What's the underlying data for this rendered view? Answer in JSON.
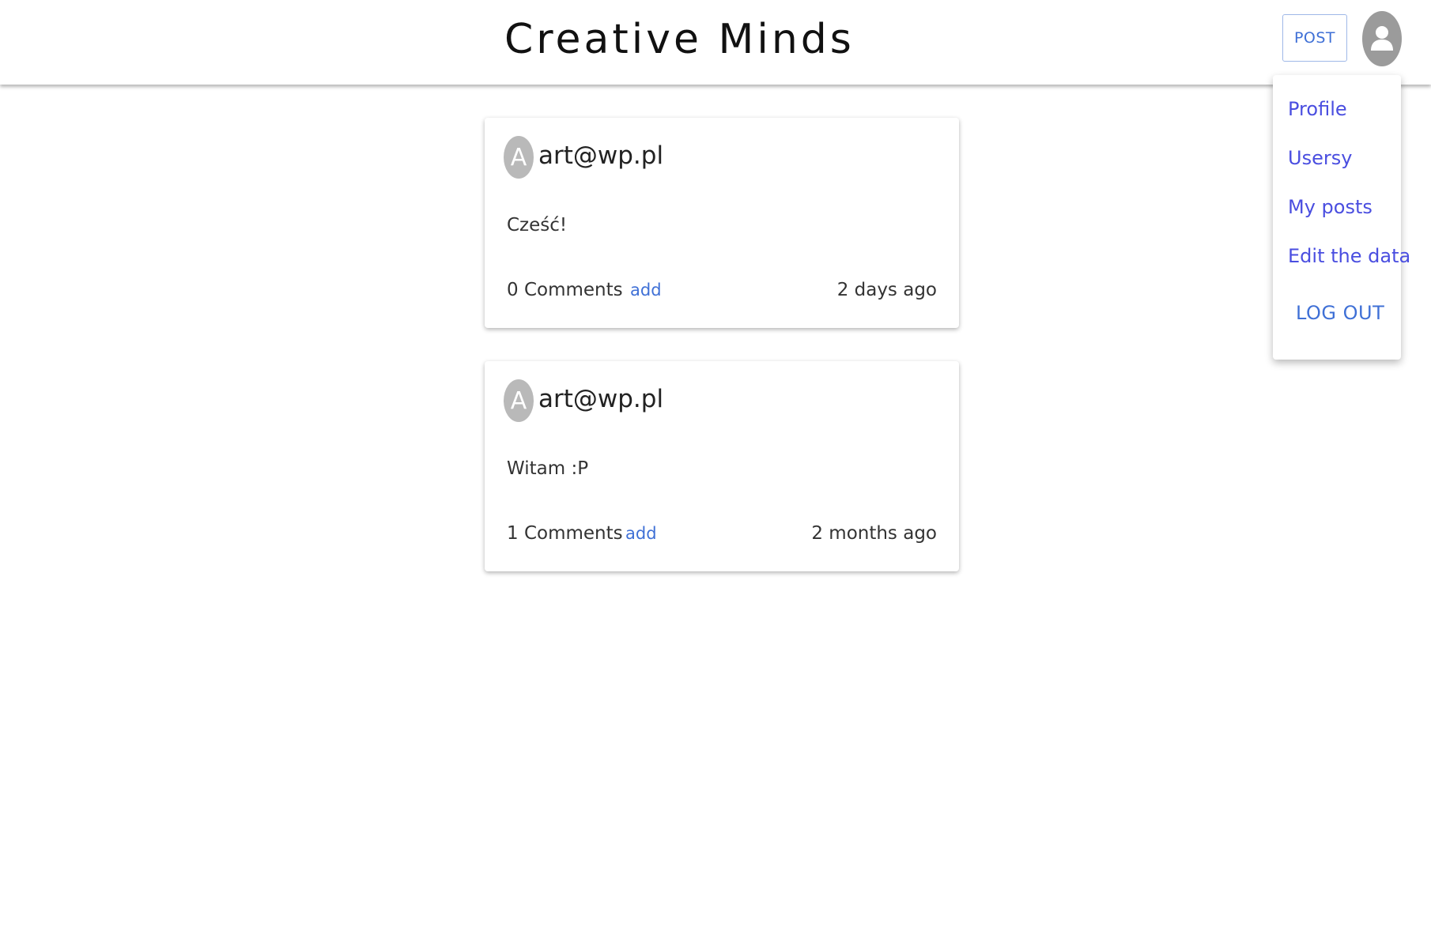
{
  "header": {
    "title": "Creative Minds",
    "post_button_label": "POST"
  },
  "user_menu": {
    "items": [
      {
        "label": "Profile"
      },
      {
        "label": "Usersy"
      },
      {
        "label": "My posts"
      },
      {
        "label": "Edit the data"
      }
    ],
    "logout_label": "LOG OUT"
  },
  "posts": [
    {
      "avatar_letter": "A",
      "author": "art@wp.pl",
      "content": "Cześć!",
      "comments_label": "0 Comments",
      "add_label": "add",
      "time": "2 days ago"
    },
    {
      "avatar_letter": "A",
      "author": "art@wp.pl",
      "content": "Witam :P",
      "comments_label": "1 Comments",
      "add_label": "add",
      "time": "2 months ago"
    }
  ],
  "icons": {
    "avatar": "user-avatar-icon"
  }
}
